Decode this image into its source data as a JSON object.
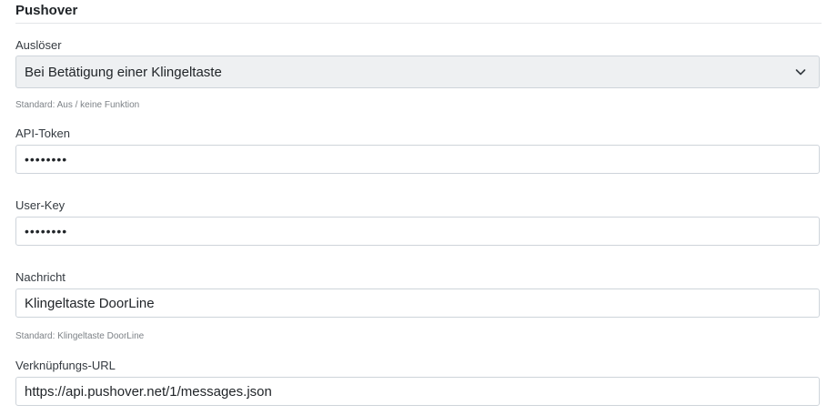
{
  "section": {
    "title": "Pushover"
  },
  "trigger": {
    "label": "Auslöser",
    "selected": "Bei Betätigung einer Klingeltaste",
    "hint": "Standard: Aus / keine Funktion"
  },
  "api_token": {
    "label": "API-Token",
    "value": "••••••••"
  },
  "user_key": {
    "label": "User-Key",
    "value": "••••••••"
  },
  "message": {
    "label": "Nachricht",
    "value": "Klingeltaste DoorLine",
    "hint": "Standard: Klingeltaste DoorLine"
  },
  "link_url": {
    "label": "Verknüpfungs-URL",
    "value": "https://api.pushover.net/1/messages.json"
  },
  "icons": {
    "select_arrow": "chevron-down-icon"
  }
}
